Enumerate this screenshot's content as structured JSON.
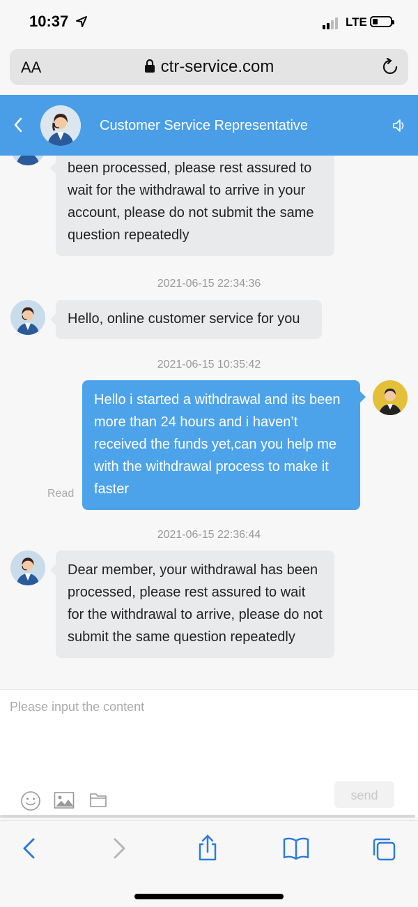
{
  "status_bar": {
    "time": "10:37",
    "network": "LTE"
  },
  "browser": {
    "text_size_label": "AA",
    "url": "ctr-service.com"
  },
  "chat_header": {
    "title": "Customer Service Representative"
  },
  "messages": [
    {
      "sender": "agent",
      "text": "been processed, please rest assured to wait for the withdrawal to arrive in your account, please do not submit the same question repeatedly"
    },
    {
      "timestamp": "2021-06-15 22:34:36"
    },
    {
      "sender": "agent",
      "text": "Hello, online customer service for you"
    },
    {
      "timestamp": "2021-06-15 10:35:42"
    },
    {
      "sender": "user",
      "text": "Hello i started a withdrawal and its been more than 24 hours and i haven’t received the funds yet,can you help me with the withdrawal process to make it faster",
      "status": "Read"
    },
    {
      "timestamp": "2021-06-15 22:36:44"
    },
    {
      "sender": "agent",
      "text": "Dear member, your withdrawal has been processed, please rest assured to wait for the withdrawal to arrive, please do not submit the same question repeatedly"
    }
  ],
  "composer": {
    "placeholder": "Please input the content",
    "send_label": "send",
    "tools": [
      "emoji-icon",
      "image-icon",
      "folder-icon"
    ]
  },
  "colors": {
    "header": "#4a9ee8",
    "outgoing_bubble": "#4da3ea",
    "incoming_bubble": "#e8eaec"
  }
}
